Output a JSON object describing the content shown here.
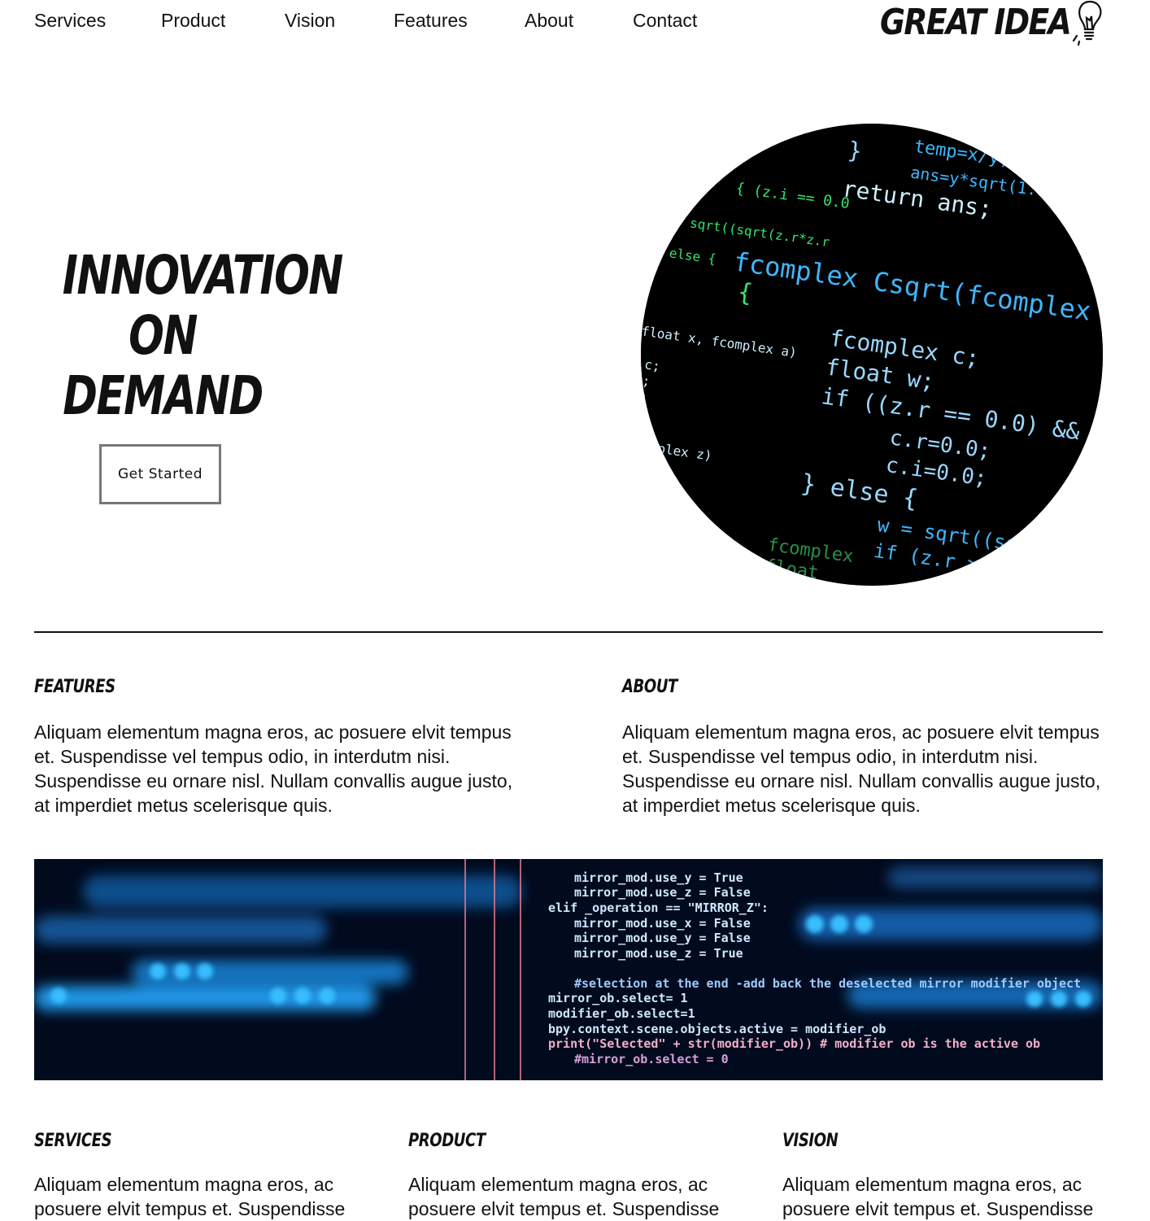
{
  "nav": {
    "items": [
      "Services",
      "Product",
      "Vision",
      "Features",
      "About",
      "Contact"
    ]
  },
  "logo": {
    "text": "GREAT IDEA",
    "icon": "lightbulb-icon"
  },
  "hero": {
    "title_lines": [
      "INNOVATION",
      "ON",
      "DEMAND"
    ],
    "cta_label": "Get Started",
    "image": "code-screen-circle-image"
  },
  "sections_top": [
    {
      "heading": "FEATURES",
      "text": "Aliquam elementum magna eros, ac posuere elvit tempus et. Suspendisse vel tempus odio, in interdutm nisi. Suspendisse eu ornare nisl. Nullam convallis augue justo, at imperdiet metus scelerisque quis."
    },
    {
      "heading": "ABOUT",
      "text": "Aliquam elementum magna eros, ac posuere elvit tempus et. Suspendisse vel tempus odio, in interdutm nisi. Suspendisse eu ornare nisl. Nullam convallis augue justo, at imperdiet metus scelerisque quis."
    }
  ],
  "banner": {
    "image": "code-banner-image"
  },
  "sections_bottom": [
    {
      "heading": "SERVICES",
      "text": "Aliquam elementum magna eros, ac posuere elvit tempus et. Suspendisse"
    },
    {
      "heading": "PRODUCT",
      "text": "Aliquam elementum magna eros, ac posuere elvit tempus et. Suspendisse"
    },
    {
      "heading": "VISION",
      "text": "Aliquam elementum magna eros, ac posuere elvit tempus et. Suspendisse"
    }
  ],
  "colors": {
    "accent_green": "#35e36a",
    "accent_blue": "#3fb6ff",
    "code_bg": "#000000",
    "banner_bg": "#020a1e"
  }
}
